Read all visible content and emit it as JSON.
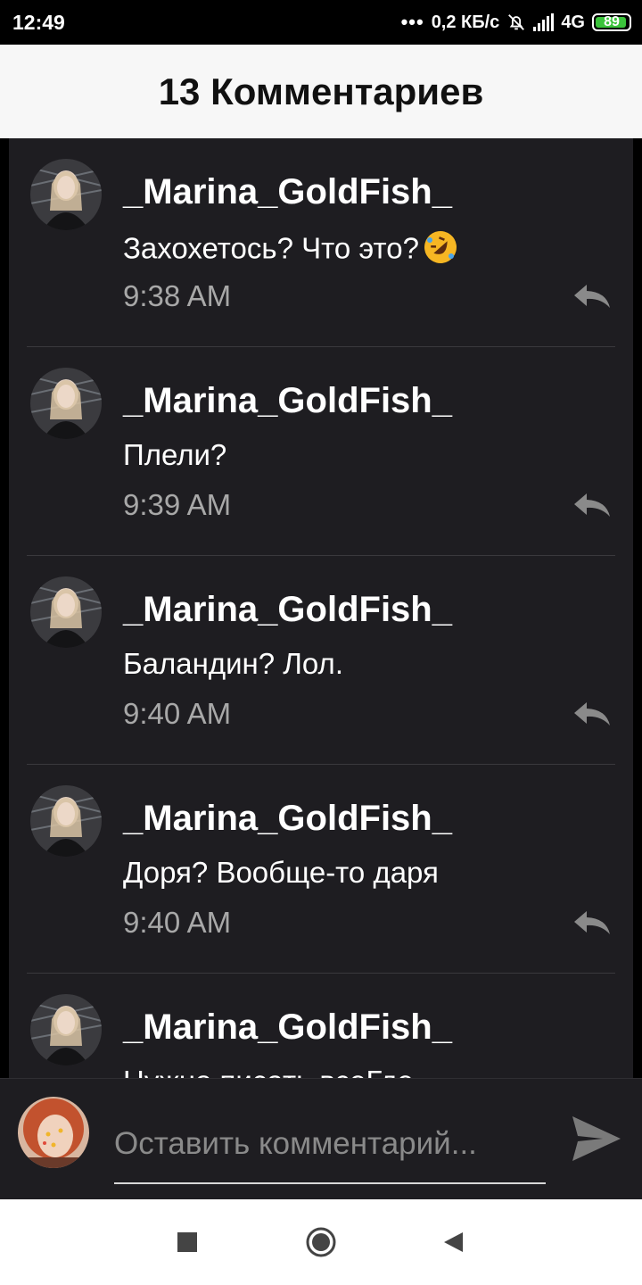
{
  "status_bar": {
    "time": "12:49",
    "dots": "•••",
    "speed": "0,2 КБ/с",
    "network": "4G",
    "battery": "89"
  },
  "header": {
    "title": "13 Комментариев"
  },
  "comments": [
    {
      "author": "_Marina_GoldFish_",
      "text": "Захохетось? Что это?",
      "emoji": "rolling-on-floor-laughing",
      "time": "9:38 AM"
    },
    {
      "author": "_Marina_GoldFish_",
      "text": "Плели?",
      "time": "9:39 AM"
    },
    {
      "author": "_Marina_GoldFish_",
      "text": "Баландин? Лол.",
      "time": "9:40 AM"
    },
    {
      "author": "_Marina_GoldFish_",
      "text": "Доря? Вообще-то даря",
      "time": "9:40 AM"
    },
    {
      "author": "_Marina_GoldFish_",
      "text": "Нужно писать всеГде",
      "time": ""
    }
  ],
  "composer": {
    "placeholder": "Оставить комментарий..."
  },
  "icons": {
    "reply": "reply-icon",
    "send": "send-icon",
    "nav": [
      "recent-apps-icon",
      "home-icon",
      "back-icon"
    ]
  }
}
